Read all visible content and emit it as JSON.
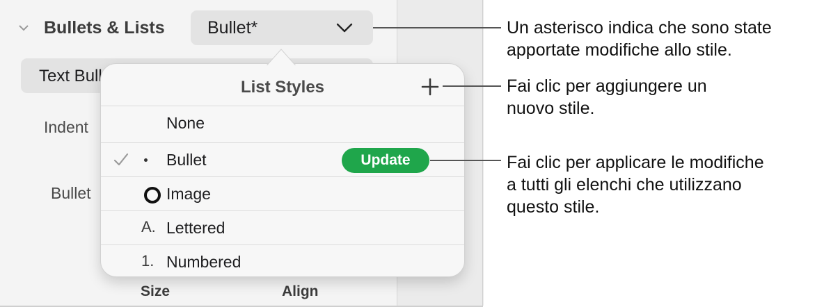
{
  "inspector": {
    "section_title": "Bullets & Lists",
    "style_dropdown_value": "Bullet*",
    "text_bullets_label": "Text Bull",
    "indent_label": "Indent",
    "bullet_label": "Bullet",
    "size_label": "Size",
    "align_label": "Align"
  },
  "popover": {
    "title": "List Styles",
    "rows": [
      {
        "marker": "",
        "name": "None",
        "checked": false
      },
      {
        "marker": "•",
        "name": "Bullet",
        "checked": true,
        "action": "Update"
      },
      {
        "marker": "circle-icon",
        "name": "Image",
        "checked": false
      },
      {
        "marker": "A.",
        "name": "Lettered",
        "checked": false
      },
      {
        "marker": "1.",
        "name": "Numbered",
        "checked": false
      }
    ],
    "update_label": "Update"
  },
  "callouts": {
    "asterisk": [
      "Un asterisco indica che sono state",
      "apportate modifiche allo stile."
    ],
    "add_style": [
      "Fai clic per aggiungere un",
      "nuovo stile."
    ],
    "apply_changes": [
      "Fai clic per applicare le modifiche",
      "a tutti gli elenchi che utilizzano",
      "questo stile."
    ]
  },
  "colors": {
    "update_button": "#1fa64b",
    "panel_bg": "#f4f4f4",
    "popover_bg": "#f7f7f7"
  }
}
